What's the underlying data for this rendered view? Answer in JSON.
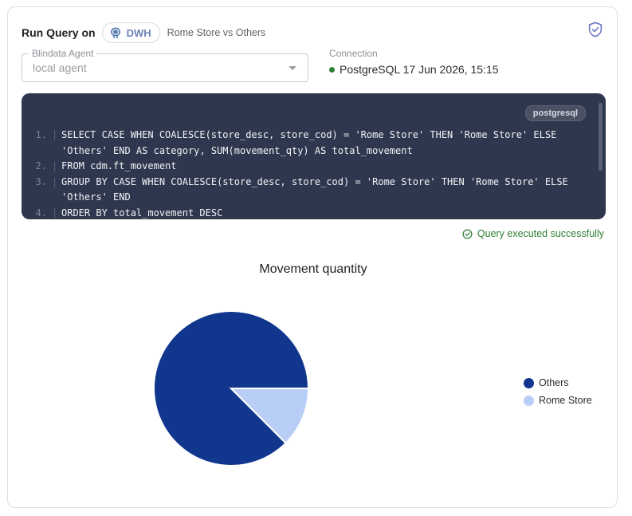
{
  "header": {
    "run_label": "Run Query on",
    "datasource_chip": {
      "label": "DWH",
      "icon": "postgres-elephant-icon"
    },
    "subtitle": "Rome Store vs Others",
    "shield_icon": "shield-check-icon"
  },
  "agent": {
    "legend": "Blindata Agent",
    "value": "local agent"
  },
  "connection": {
    "label": "Connection",
    "status_color": "#2e7d32",
    "value": "PostgreSQL 17 Jun 2026, 15:15"
  },
  "code": {
    "language": "postgresql",
    "lines": [
      {
        "num": "1.",
        "text": "SELECT CASE WHEN COALESCE(store_desc, store_cod) = 'Rome Store' THEN 'Rome Store' ELSE\n'Others' END AS category, SUM(movement_qty) AS total_movement"
      },
      {
        "num": "2.",
        "text": "FROM cdm.ft_movement"
      },
      {
        "num": "3.",
        "text": "GROUP BY CASE WHEN COALESCE(store_desc, store_cod) = 'Rome Store' THEN 'Rome Store' ELSE\n'Others' END"
      },
      {
        "num": "4.",
        "text": "ORDER BY total_movement DESC"
      }
    ]
  },
  "status": {
    "text": "Query executed successfully",
    "color": "#2e7d32"
  },
  "chart_data": {
    "type": "pie",
    "title": "Movement quantity",
    "categories": [
      "Others",
      "Rome Store"
    ],
    "values": [
      87.5,
      12.5
    ],
    "colors": [
      "#10368e",
      "#b8cef6"
    ],
    "legend_position": "right"
  }
}
